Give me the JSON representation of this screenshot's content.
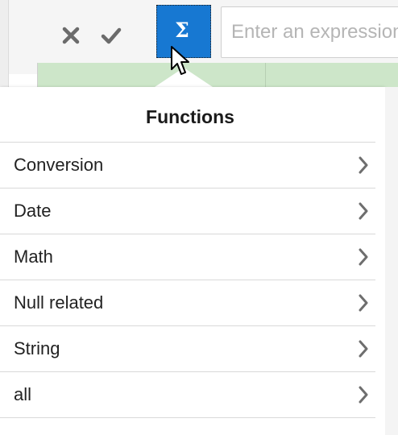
{
  "toolbar": {
    "cancel_icon": "close-x-icon",
    "confirm_icon": "checkmark-icon",
    "sigma_label": "Σ",
    "expression_placeholder": "Enter an expression",
    "accent_color": "#1778d2"
  },
  "functions_popup": {
    "title": "Functions",
    "items": [
      {
        "label": "Conversion",
        "icon": "chevron-right-icon"
      },
      {
        "label": "Date",
        "icon": "chevron-right-icon"
      },
      {
        "label": "Math",
        "icon": "chevron-right-icon"
      },
      {
        "label": "Null related",
        "icon": "chevron-right-icon"
      },
      {
        "label": "String",
        "icon": "chevron-right-icon"
      },
      {
        "label": "all",
        "icon": "chevron-right-icon"
      }
    ]
  }
}
